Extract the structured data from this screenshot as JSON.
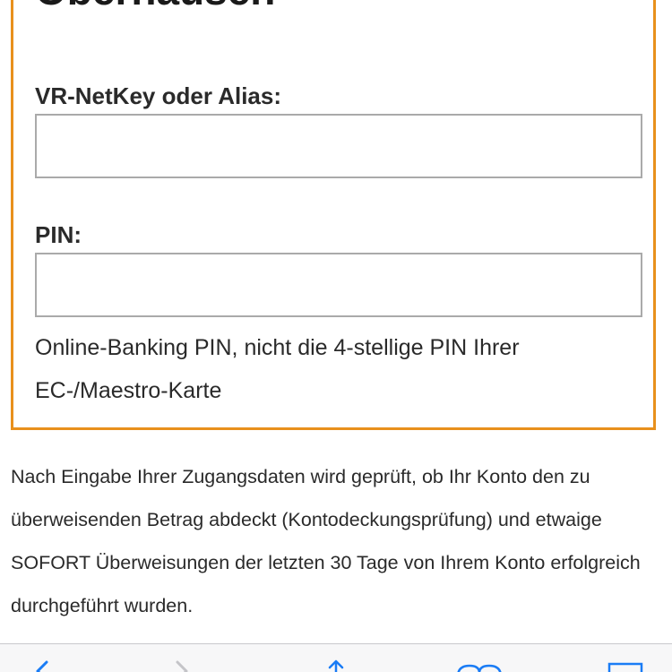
{
  "login": {
    "bank_title": "Oberhausen",
    "username_label": "VR-NetKey oder Alias:",
    "username_value": "",
    "username_placeholder": "",
    "pin_label": "PIN:",
    "pin_value": "",
    "pin_placeholder": "",
    "pin_hint": "Online-Banking PIN, nicht die 4-stellige PIN Ihrer EC-/Maestro-Karte"
  },
  "info_text": "Nach Eingabe Ihrer Zugangsdaten wird geprüft, ob Ihr Konto den zu überweisenden Betrag abdeckt (Kontodeckungsprüfung) und etwaige SOFORT Überweisungen der letzten 30 Tage von Ihrem Konto erfolgreich durchgeführt wurden.",
  "toolbar": {
    "icons": [
      "back-arrow-icon",
      "forward-arrow-icon",
      "share-icon",
      "bookmarks-icon",
      "tabs-icon"
    ],
    "icon_color": "#1a7cf5",
    "disabled_color": "#c4c4c8"
  },
  "colors": {
    "panel_border": "#e8901c",
    "input_border": "#aaaaaa",
    "text": "#2a2a2a"
  }
}
